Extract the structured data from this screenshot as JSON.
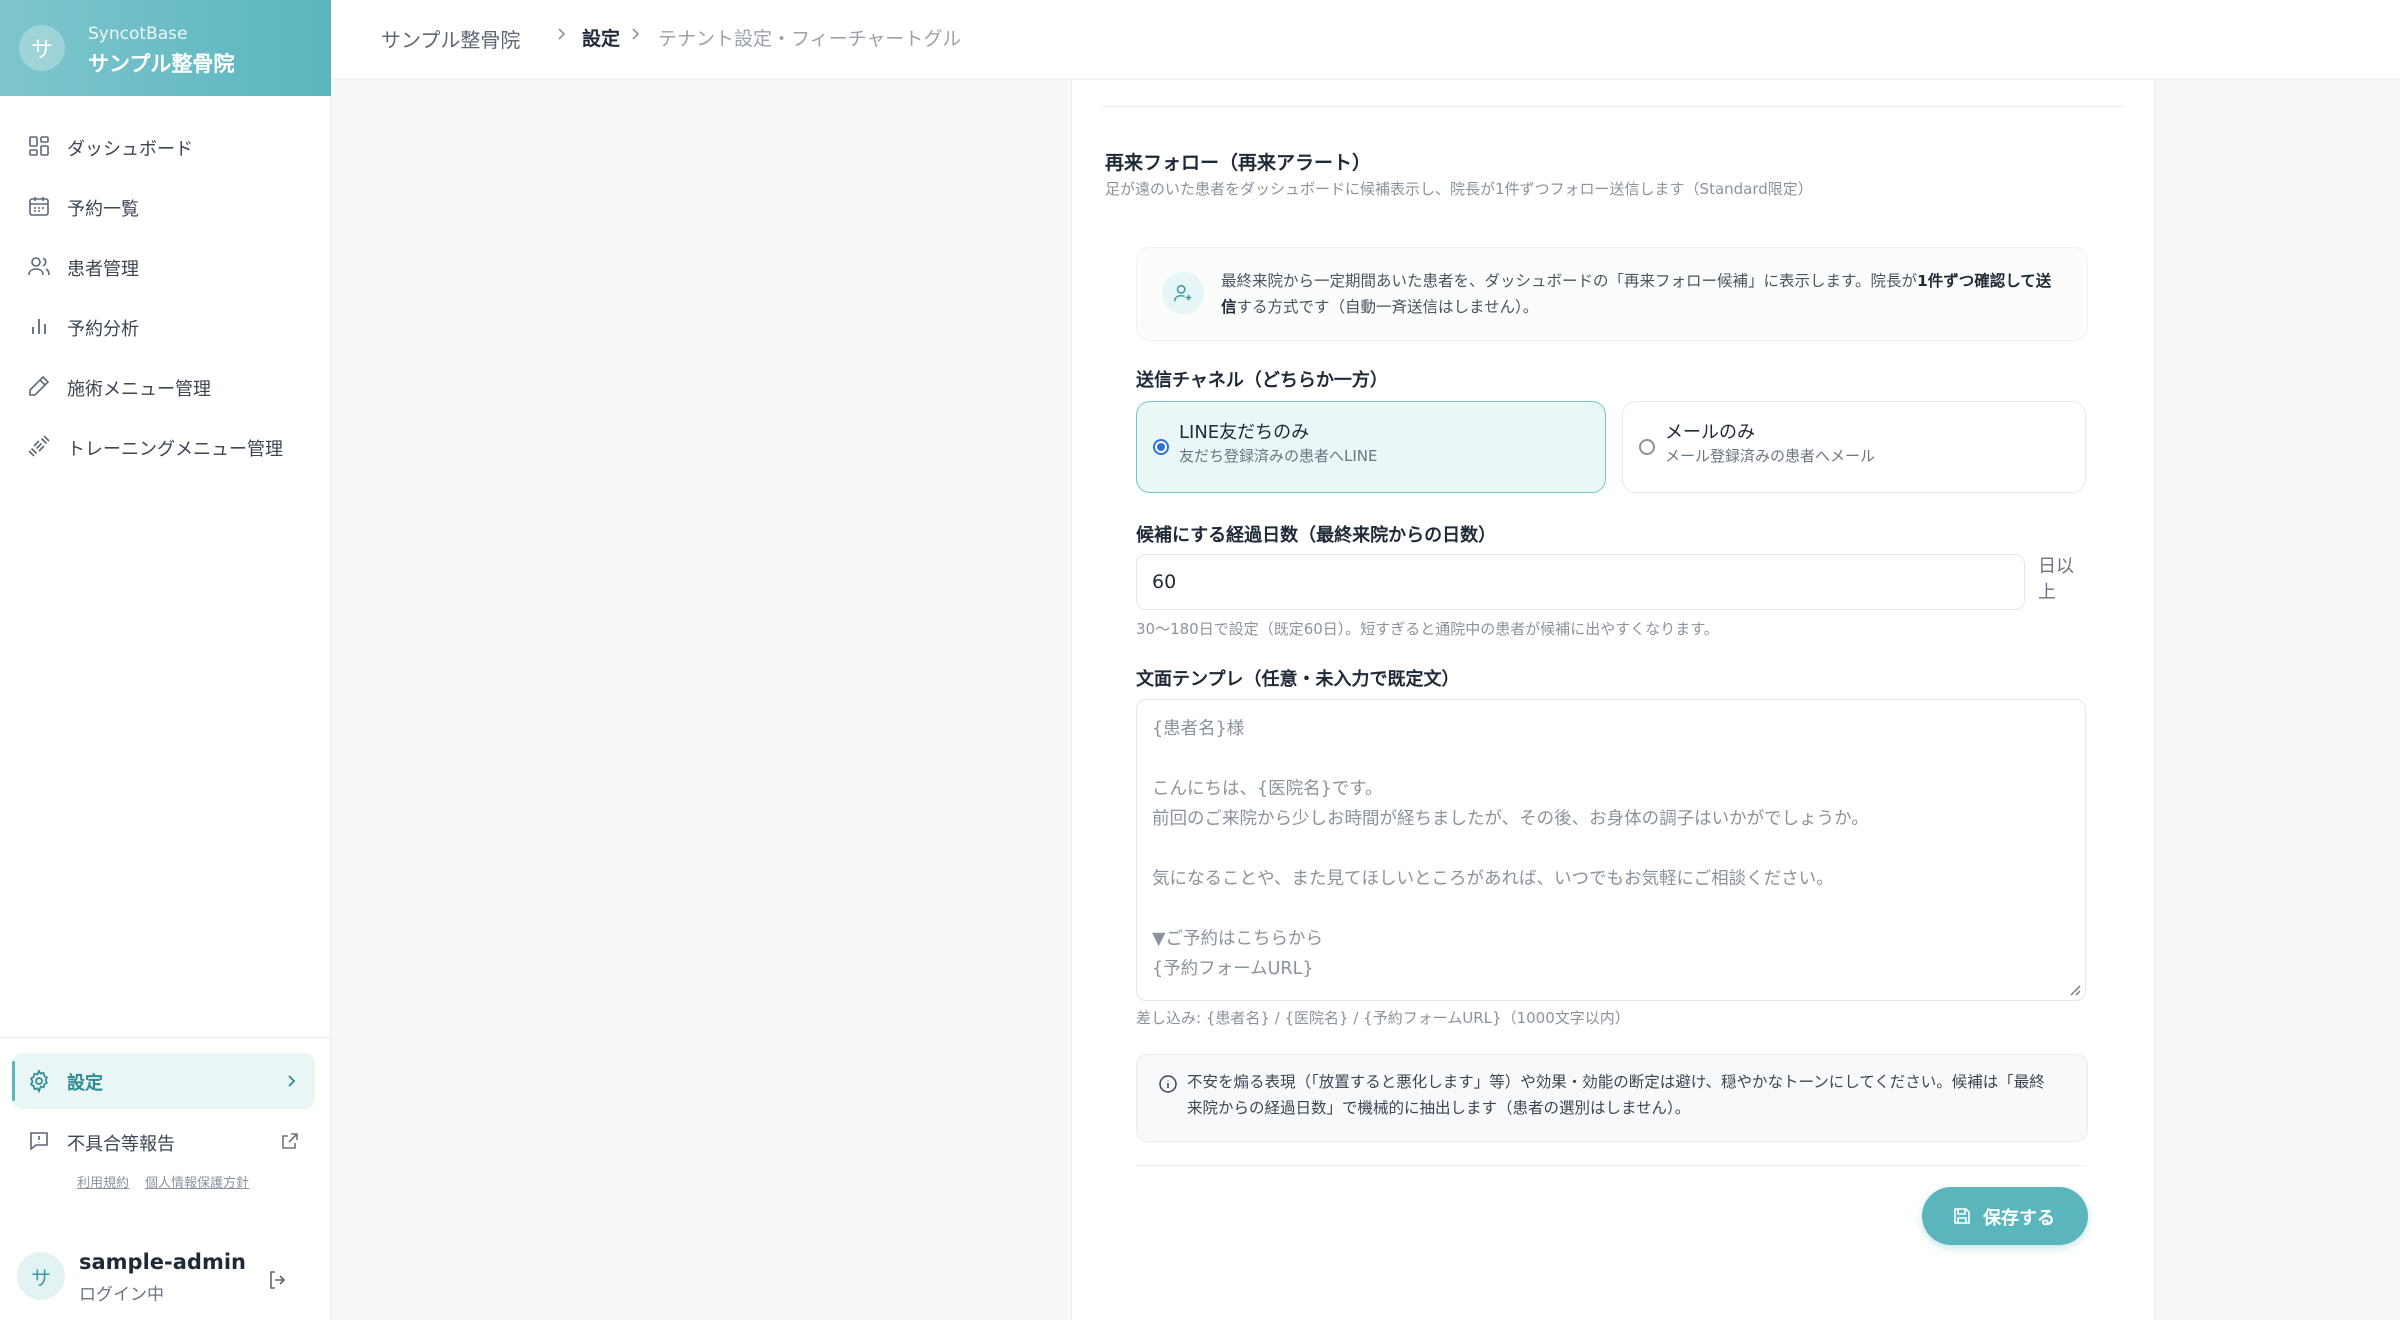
{
  "brand": {
    "avatar_char": "サ",
    "product": "SyncotBase",
    "clinic": "サンプル整骨院"
  },
  "sidebar": {
    "items": [
      {
        "label": "ダッシュボード",
        "icon": "dashboard-icon"
      },
      {
        "label": "予約一覧",
        "icon": "calendar-icon"
      },
      {
        "label": "患者管理",
        "icon": "users-icon"
      },
      {
        "label": "予約分析",
        "icon": "bar-chart-icon"
      },
      {
        "label": "施術メニュー管理",
        "icon": "pen-icon"
      },
      {
        "label": "トレーニングメニュー管理",
        "icon": "dumbbell-icon"
      }
    ],
    "settings_label": "設定",
    "report_label": "不具合等報告",
    "terms_label": "利用規約",
    "privacy_label": "個人情報保護方針"
  },
  "user": {
    "avatar_char": "サ",
    "name": "sample-admin",
    "status": "ログイン中"
  },
  "breadcrumb": [
    "サンプル整骨院",
    "設定",
    "テナント設定・フィーチャートグル"
  ],
  "section": {
    "title": "再来フォロー（再来アラート）",
    "description": "足が遠のいた患者をダッシュボードに候補表示し、院長が1件ずつフォロー送信します（Standard限定）",
    "info_pre": "最終来院から一定期間あいた患者を、ダッシュボードの「再来フォロー候補」に表示します。院長が",
    "info_bold": "1件ずつ確認して送信",
    "info_post": "する方式です（自動一斉送信はしません）。"
  },
  "channel": {
    "label": "送信チャネル（どちらか一方）",
    "options": [
      {
        "title": "LINE友だちのみ",
        "sub": "友だち登録済みの患者へLINE",
        "selected": true
      },
      {
        "title": "メールのみ",
        "sub": "メール登録済みの患者へメール",
        "selected": false
      }
    ]
  },
  "days": {
    "label": "候補にする経過日数（最終来院からの日数）",
    "value": "60",
    "unit": "日以上",
    "help": "30〜180日で設定（既定60日）。短すぎると通院中の患者が候補に出やすくなります。"
  },
  "template": {
    "label": "文面テンプレ（任意・未入力で既定文）",
    "placeholder_lines": [
      "{患者名}様",
      "",
      "こんにちは、{医院名}です。",
      "前回のご来院から少しお時間が経ちましたが、その後、お身体の調子はいかがでしょうか。",
      "",
      "気になることや、また見てほしいところがあれば、いつでもお気軽にご相談ください。",
      "",
      "▼ご予約はこちらから",
      "{予約フォームURL}"
    ],
    "help": "差し込み: {患者名} / {医院名} / {予約フォームURL}（1000文字以内）"
  },
  "notice": "不安を煽る表現（「放置すると悪化します」等）や効果・効能の断定は避け、穏やかなトーンにしてください。候補は「最終来院からの経過日数」で機械的に抽出します（患者の選別はしません）。",
  "save_label": "保存する",
  "colors": {
    "accent": "#5bb5bd",
    "accent_soft": "#eaf7f7",
    "radio": "#2f6fde"
  }
}
